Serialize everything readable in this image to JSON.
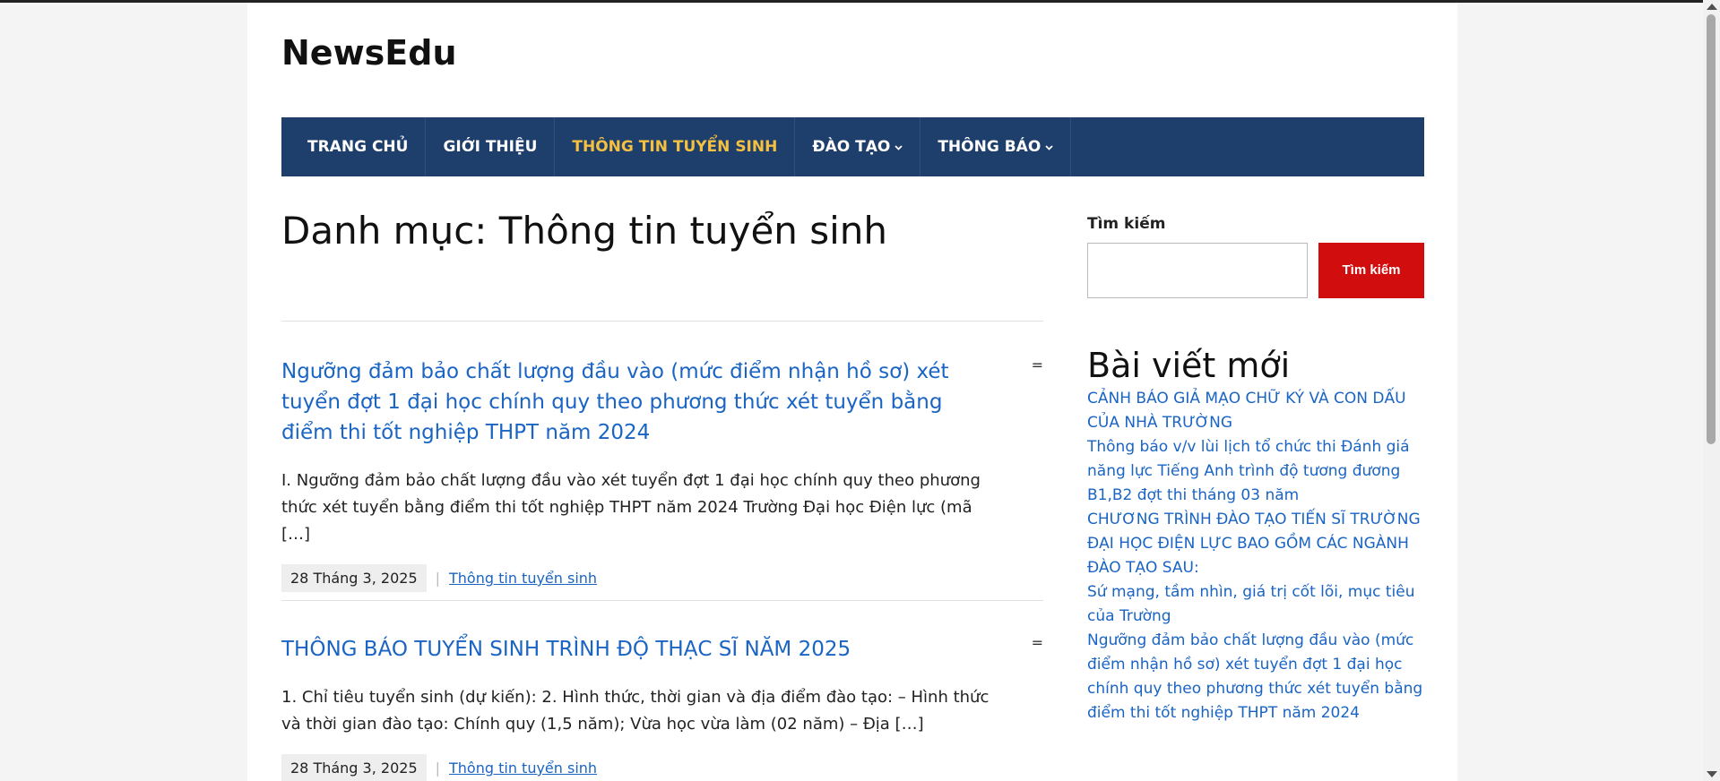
{
  "site": {
    "title": "NewsEdu"
  },
  "nav": {
    "items": [
      {
        "label": "TRANG CHỦ",
        "dropdown": false
      },
      {
        "label": "GIỚI THIỆU",
        "dropdown": false
      },
      {
        "label": "THÔNG TIN TUYỂN SINH",
        "dropdown": false,
        "active": true
      },
      {
        "label": "ĐÀO TẠO",
        "dropdown": true
      },
      {
        "label": "THÔNG BÁO",
        "dropdown": true
      }
    ],
    "active_color": "#f5c040",
    "background": "#1e3f6c"
  },
  "main": {
    "page_title": "Danh mục: Thông tin tuyển sinh",
    "posts": [
      {
        "title": "Ngưỡng đảm bảo chất lượng đầu vào (mức điểm nhận hồ sơ) xét tuyển đợt 1 đại học chính quy theo phương thức xét tuyển bằng điểm thi tốt nghiệp THPT năm 2024",
        "excerpt": "I. Ngưỡng đảm bảo chất lượng đầu vào xét tuyển đợt 1 đại học chính quy theo phương thức xét tuyển bằng điểm thi tốt nghiệp THPT năm 2024 Trường Đại học Điện lực (mã […]",
        "date": "28 Tháng 3, 2025",
        "category": "Thông tin tuyển sinh",
        "menu_mark": "="
      },
      {
        "title": "THÔNG BÁO TUYỂN SINH TRÌNH ĐỘ THẠC SĨ NĂM 2025",
        "excerpt": "1. Chỉ tiêu tuyển sinh (dự kiến): 2. Hình thức, thời gian và địa điểm đào tạo: – Hình thức và thời gian đào tạo: Chính quy (1,5 năm); Vừa học vừa làm (02 năm) – Địa […]",
        "date": "28 Tháng 3, 2025",
        "category": "Thông tin tuyển sinh",
        "menu_mark": "="
      }
    ],
    "meta_separator": "|",
    "link_color": "#1a64c4"
  },
  "sidebar": {
    "search": {
      "label": "Tìm kiếm",
      "button_label": "Tìm kiếm",
      "button_color": "#d10d0d"
    },
    "recent": {
      "title": "Bài viết mới",
      "items": [
        "CẢNH BÁO GIẢ MẠO CHỮ KÝ VÀ CON DẤU CỦA NHÀ TRƯỜNG",
        "Thông báo v/v lùi lịch tổ chức thi Đánh giá năng lực Tiếng Anh trình độ tương đương B1,B2 đợt thi tháng 03 năm",
        "CHƯƠNG TRÌNH ĐÀO TẠO TIẾN SĨ TRƯỜNG ĐẠI HỌC ĐIỆN LỰC BAO GỒM CÁC NGÀNH ĐÀO TẠO SAU:",
        "Sứ mạng, tầm nhìn, giá trị cốt lõi, mục tiêu của Trường",
        "Ngưỡng đảm bảo chất lượng đầu vào (mức điểm nhận hồ sơ) xét tuyển đợt 1 đại học chính quy theo phương thức xét tuyển bằng điểm thi tốt nghiệp THPT năm 2024"
      ]
    }
  }
}
